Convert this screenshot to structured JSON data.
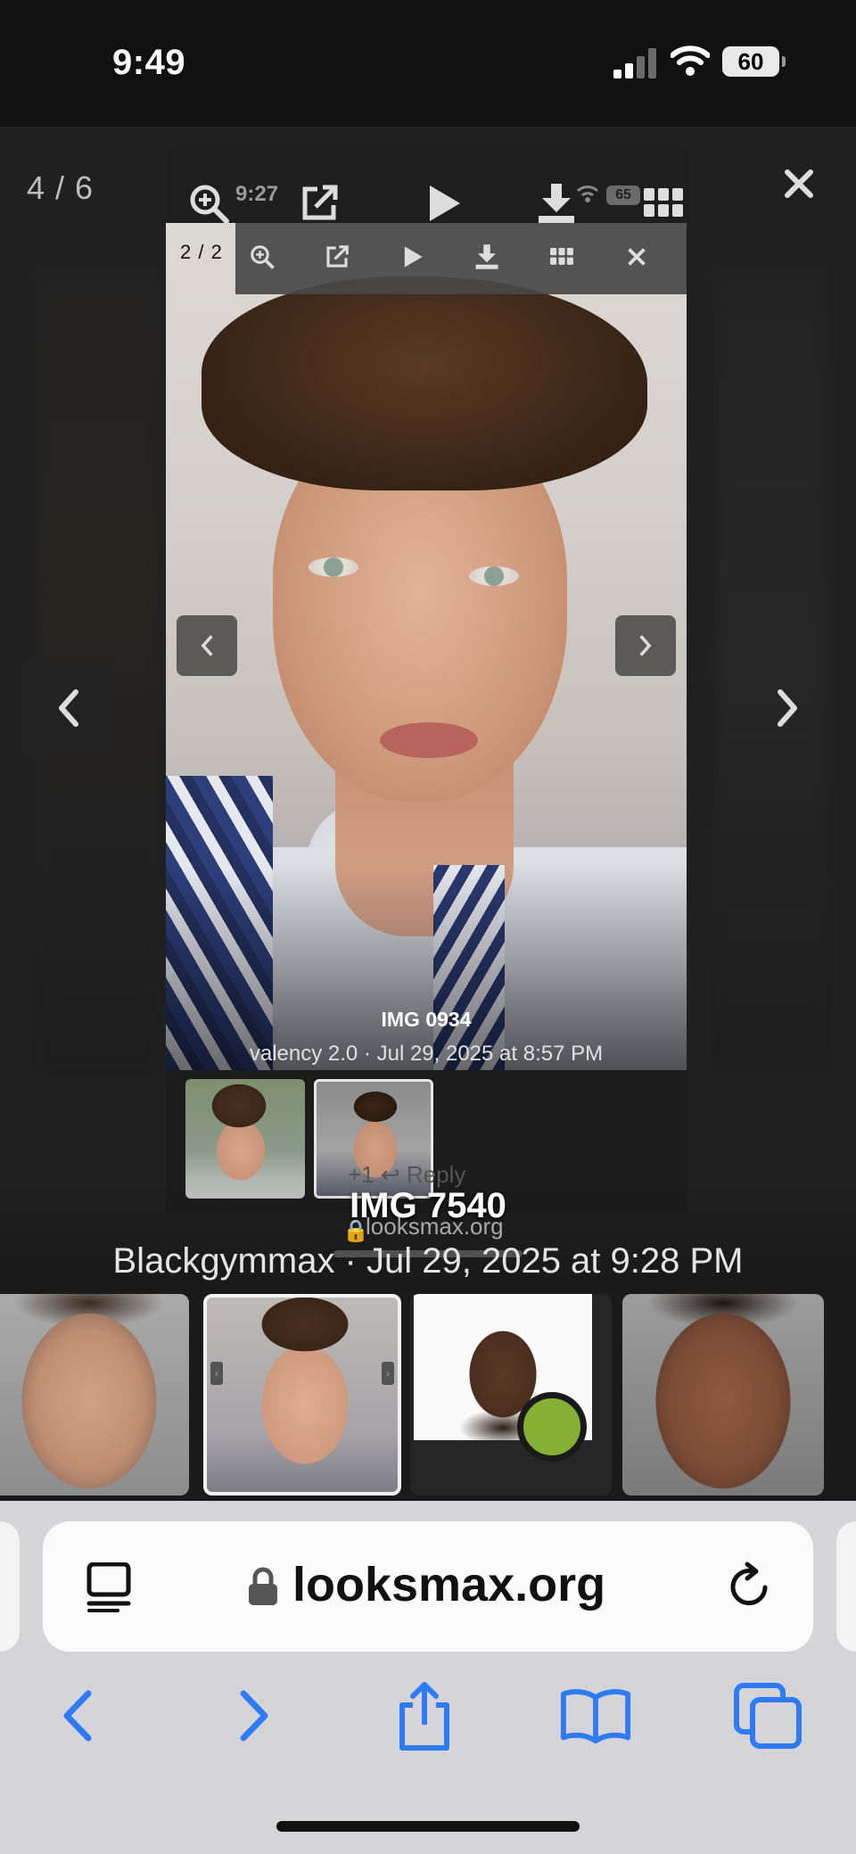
{
  "status_bar": {
    "time": "9:49",
    "battery": "60"
  },
  "viewer": {
    "counter": "4 / 6",
    "outer_toolbar": {
      "time_snippet": "9:27",
      "battery_snippet": "65"
    },
    "inner_screenshot": {
      "counter": "2 / 2",
      "title": "IMG 0934",
      "meta": "valency 2.0 · Jul 29, 2025 at 8:57 PM"
    },
    "ghost_react": "+1   ↩ Reply",
    "caption_title": "IMG 7540",
    "caption_domain": "looksmax.org",
    "caption_meta": "Blackgymmax · Jul 29, 2025 at 9:28 PM"
  },
  "browser": {
    "url": "looksmax.org"
  },
  "colors": {
    "accent": "#2f7bf5",
    "online": "#86b034"
  },
  "icons": [
    "zoom-in-icon",
    "external-link-icon",
    "play-icon",
    "download-icon",
    "grid-icon",
    "close-icon",
    "chevron-left-icon",
    "chevron-right-icon",
    "reader-icon",
    "lock-icon",
    "reload-icon",
    "back-icon",
    "forward-icon",
    "share-icon",
    "bookmarks-icon",
    "tabs-icon"
  ]
}
